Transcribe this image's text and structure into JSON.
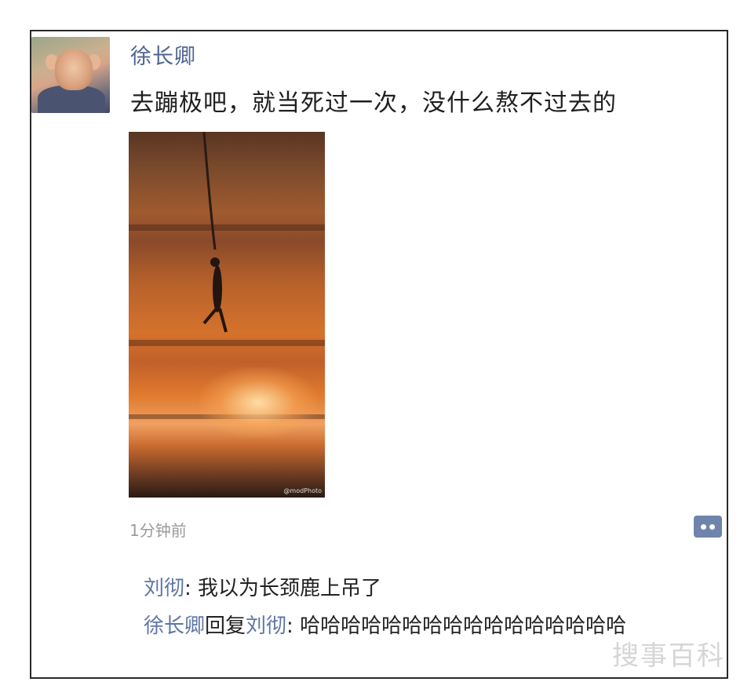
{
  "post": {
    "username": "徐长卿",
    "text": "去蹦极吧，就当死过一次，没什么熬不过去的",
    "image_alt": "bungee jumper silhouette over sunset",
    "image_watermark": "@modPhoto",
    "time": "1分钟前"
  },
  "comments": [
    {
      "author": "刘彻",
      "separator": ": ",
      "text": "我以为长颈鹿上吊了"
    },
    {
      "author": "徐长卿",
      "reply_label": "回复",
      "reply_to": "刘彻",
      "separator": ": ",
      "text": "哈哈哈哈哈哈哈哈哈哈哈哈哈哈哈哈"
    }
  ],
  "watermark": "搜事百科",
  "icons": {
    "comment": "comment-bubble-icon"
  },
  "colors": {
    "name": "#5e76a6",
    "username": "#4f6591",
    "time": "#9b9b9b",
    "accent": "#6e84ac"
  }
}
